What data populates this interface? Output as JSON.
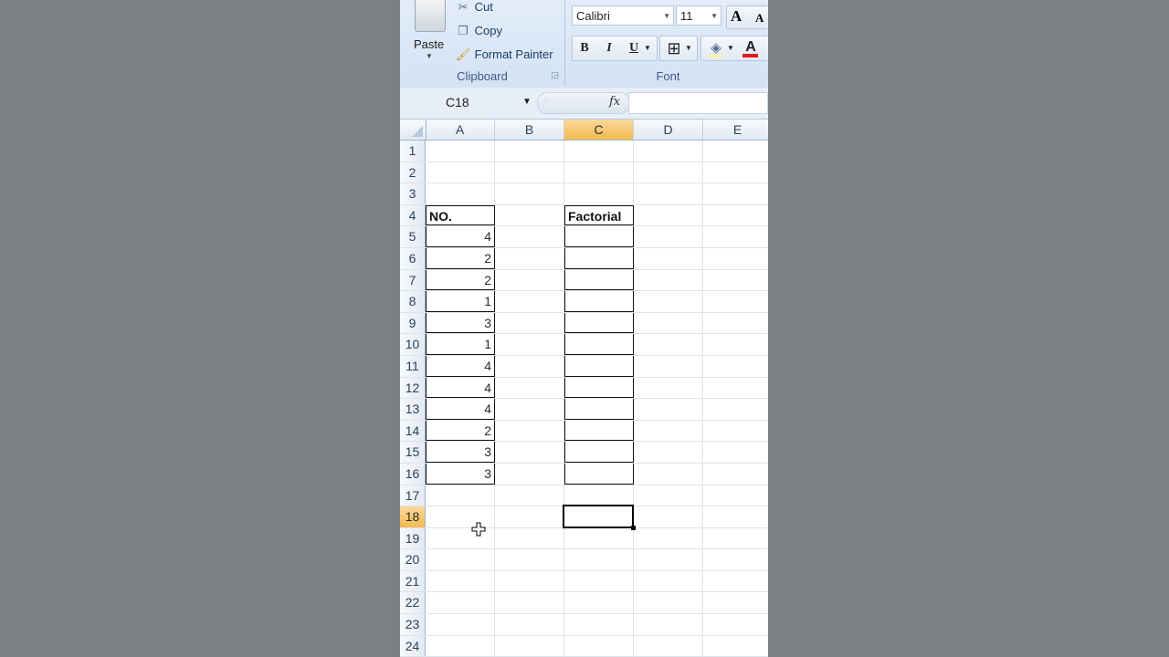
{
  "ribbon": {
    "clipboard": {
      "paste_label": "Paste",
      "cut_label": "Cut",
      "copy_label": "Copy",
      "format_painter_label": "Format Painter",
      "group_label": "Clipboard"
    },
    "font": {
      "font_name": "Calibri",
      "font_size": "11",
      "bold": "B",
      "italic": "I",
      "underline": "U",
      "grow_font": "A",
      "shrink_font": "A",
      "font_color": "A",
      "group_label": "Font"
    }
  },
  "formula_bar": {
    "name_box": "C18",
    "fx_label": "fx",
    "formula": ""
  },
  "columns": [
    "A",
    "B",
    "C",
    "D",
    "E"
  ],
  "active_column": "C",
  "active_row": 18,
  "rows": [
    {
      "n": "1",
      "a": "",
      "c": ""
    },
    {
      "n": "2",
      "a": "",
      "c": ""
    },
    {
      "n": "3",
      "a": "",
      "c": ""
    },
    {
      "n": "4",
      "a": "NO.",
      "c": "Factorial"
    },
    {
      "n": "5",
      "a": "4",
      "c": ""
    },
    {
      "n": "6",
      "a": "2",
      "c": ""
    },
    {
      "n": "7",
      "a": "2",
      "c": ""
    },
    {
      "n": "8",
      "a": "1",
      "c": ""
    },
    {
      "n": "9",
      "a": "3",
      "c": ""
    },
    {
      "n": "10",
      "a": "1",
      "c": ""
    },
    {
      "n": "11",
      "a": "4",
      "c": ""
    },
    {
      "n": "12",
      "a": "4",
      "c": ""
    },
    {
      "n": "13",
      "a": "4",
      "c": ""
    },
    {
      "n": "14",
      "a": "2",
      "c": ""
    },
    {
      "n": "15",
      "a": "3",
      "c": ""
    },
    {
      "n": "16",
      "a": "3",
      "c": ""
    },
    {
      "n": "17",
      "a": "",
      "c": ""
    },
    {
      "n": "18",
      "a": "",
      "c": ""
    },
    {
      "n": "19",
      "a": "",
      "c": ""
    },
    {
      "n": "20",
      "a": "",
      "c": ""
    },
    {
      "n": "21",
      "a": "",
      "c": ""
    },
    {
      "n": "22",
      "a": "",
      "c": ""
    },
    {
      "n": "23",
      "a": "",
      "c": ""
    },
    {
      "n": "24",
      "a": "",
      "c": ""
    }
  ],
  "colors": {
    "accent_header": "#f2b94f",
    "ribbon_bg": "#dbe6f4",
    "font_color_bar": "#e01b1b"
  }
}
